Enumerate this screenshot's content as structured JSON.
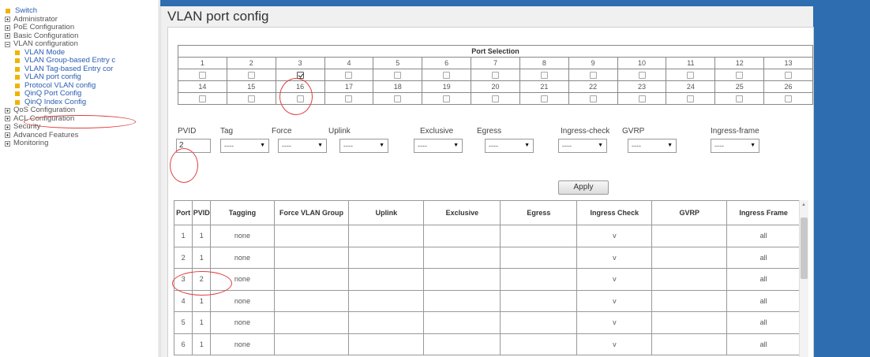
{
  "sidebar": {
    "items": [
      {
        "label": "Switch",
        "type": "root"
      },
      {
        "label": "Administrator",
        "type": "plus"
      },
      {
        "label": "PoE Configuration",
        "type": "plus"
      },
      {
        "label": "Basic Configuration",
        "type": "plus"
      },
      {
        "label": "VLAN configuration",
        "type": "minus"
      },
      {
        "label": "VLAN Mode",
        "type": "child"
      },
      {
        "label": "VLAN Group-based Entry c",
        "type": "child"
      },
      {
        "label": "VLAN Tag-based Entry cor",
        "type": "child"
      },
      {
        "label": "VLAN port config",
        "type": "child"
      },
      {
        "label": "Protocol VLAN config",
        "type": "child"
      },
      {
        "label": "QinQ Port Config",
        "type": "child"
      },
      {
        "label": "QinQ Index Config",
        "type": "child"
      },
      {
        "label": "QoS Configuration",
        "type": "plus"
      },
      {
        "label": "ACL Configuration",
        "type": "plus"
      },
      {
        "label": "Security",
        "type": "plus"
      },
      {
        "label": "Advanced Features",
        "type": "plus"
      },
      {
        "label": "Monitoring",
        "type": "plus"
      }
    ]
  },
  "page_title": "VLAN port config",
  "port_selection": {
    "header": "Port Selection",
    "row1_ports": [
      "1",
      "2",
      "3",
      "4",
      "5",
      "6",
      "7",
      "8",
      "9",
      "10",
      "11",
      "12",
      "13"
    ],
    "row2_ports": [
      "14",
      "15",
      "16",
      "17",
      "18",
      "19",
      "20",
      "21",
      "22",
      "23",
      "24",
      "25",
      "26"
    ],
    "checked_ports": [
      "3"
    ]
  },
  "config": {
    "pvid_label": "PVID",
    "pvid_value": "2",
    "fields": [
      {
        "label": "Tag",
        "value": "----"
      },
      {
        "label": "Force",
        "value": "----"
      },
      {
        "label": "Uplink",
        "value": "----"
      },
      {
        "label": "Exclusive",
        "value": "----"
      },
      {
        "label": "Egress",
        "value": "----"
      },
      {
        "label": "Ingress-check",
        "value": "----"
      },
      {
        "label": "GVRP",
        "value": "----"
      },
      {
        "label": "Ingress-frame",
        "value": "----"
      }
    ],
    "apply_label": "Apply"
  },
  "vlan_table": {
    "columns": [
      "Port",
      "PVID",
      "Tagging",
      "Force VLAN Group",
      "Uplink",
      "Exclusive",
      "Egress",
      "Ingress Check",
      "GVRP",
      "Ingress Frame"
    ],
    "rows": [
      [
        "1",
        "1",
        "none",
        "",
        "",
        "",
        "",
        "v",
        "",
        "all"
      ],
      [
        "2",
        "1",
        "none",
        "",
        "",
        "",
        "",
        "v",
        "",
        "all"
      ],
      [
        "3",
        "2",
        "none",
        "",
        "",
        "",
        "",
        "v",
        "",
        "all"
      ],
      [
        "4",
        "1",
        "none",
        "",
        "",
        "",
        "",
        "v",
        "",
        "all"
      ],
      [
        "5",
        "1",
        "none",
        "",
        "",
        "",
        "",
        "v",
        "",
        "all"
      ],
      [
        "6",
        "1",
        "none",
        "",
        "",
        "",
        "",
        "v",
        "",
        "all"
      ]
    ]
  },
  "colors": {
    "brand_blue": "#2e6db0",
    "annotation_red": "#e04040",
    "tree_icon": "#f0b400"
  }
}
